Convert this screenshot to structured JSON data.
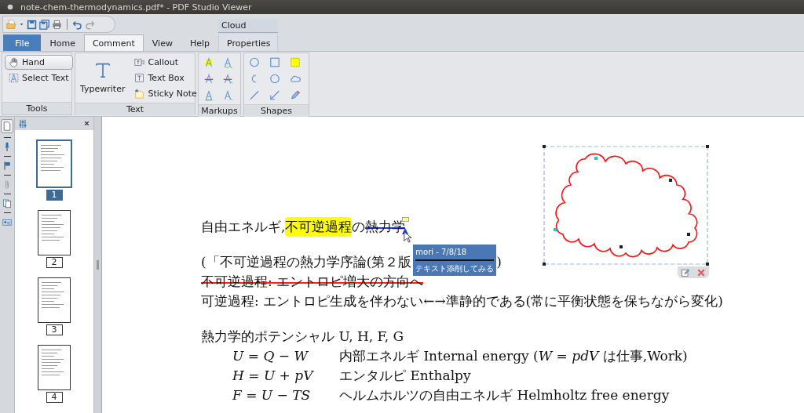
{
  "window": {
    "title": "note-chem-thermodynamics.pdf* - PDF Studio Viewer"
  },
  "tabs": [
    {
      "label": "File",
      "kind": "file",
      "selected": false
    },
    {
      "label": "Home",
      "kind": "tab",
      "selected": false
    },
    {
      "label": "Comment",
      "kind": "tab",
      "selected": true
    },
    {
      "label": "View",
      "kind": "tab",
      "selected": false
    },
    {
      "label": "Help",
      "kind": "tab",
      "selected": false
    },
    {
      "label": "Properties",
      "kind": "context",
      "group": "Cloud",
      "selected": false
    }
  ],
  "ribbon": [
    {
      "label": "Tools",
      "kind": "buttons",
      "items": [
        {
          "label": "Hand",
          "kind": "toggle",
          "selected": true
        },
        {
          "label": "Select Text",
          "kind": "small",
          "selected": false
        }
      ]
    },
    {
      "label": "Text",
      "kind": "buttons",
      "items": [
        {
          "label": "Typewriter",
          "kind": "large",
          "selected": false
        },
        {
          "label": "Callout",
          "kind": "small",
          "selected": false
        },
        {
          "label": "Text Box",
          "kind": "small",
          "selected": false
        },
        {
          "label": "Sticky Note",
          "kind": "small",
          "selected": false
        }
      ]
    },
    {
      "label": "Markups",
      "kind": "markups"
    },
    {
      "label": "Shapes",
      "kind": "shapes"
    }
  ],
  "thumbnails": [
    {
      "label": "1",
      "selected": true
    },
    {
      "label": "2",
      "selected": false
    },
    {
      "label": "3",
      "selected": false
    },
    {
      "label": "4",
      "selected": false
    }
  ],
  "document": {
    "lines": [
      {
        "kind": "annotated",
        "segments": [
          {
            "text": "自由エネルギ, ",
            "kind": "plain"
          },
          {
            "text": "不可逆過程",
            "kind": "highlight"
          },
          {
            "text": "の",
            "kind": "plain"
          },
          {
            "text": "熱力学",
            "kind": "strike"
          }
        ]
      },
      {
        "kind": "covered",
        "before": "(「不可逆過程の熱力学序論(第２版",
        "after": ")"
      },
      {
        "kind": "struck",
        "text": "不可逆過程: エントロピ増大の方向へ"
      },
      {
        "kind": "plain",
        "text": "可逆過程: エントロピ生成を伴わない←→準静的である(常に平衡状態を保ちながら変化)"
      },
      {
        "kind": "heading",
        "text": "熱力学的ポテンシャル U, H, F, G"
      }
    ],
    "formulas": [
      {
        "formula": "*U* = *Q* − *W*",
        "text": "内部エネルギ Internal energy (*W* = *pdV* は仕事,Work)"
      },
      {
        "formula": "*H* = *U* + *pV*",
        "text": "エンタルピ Enthalpy"
      },
      {
        "formula": "*F* = *U* − *TS*",
        "text": "ヘルムホルツの自由エネルギ Helmholtz free energy"
      }
    ],
    "note": {
      "author": "mori - 7/8/18",
      "text": "テキスト添削してみる"
    }
  }
}
